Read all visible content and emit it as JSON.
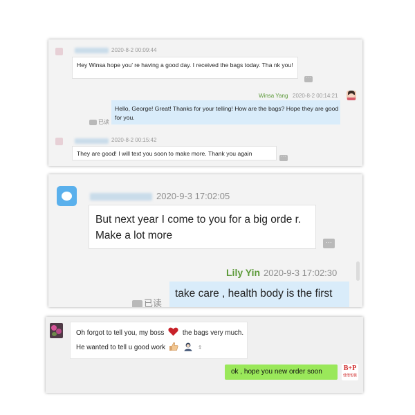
{
  "panel1": {
    "msg1": {
      "time": "2020-8-2 00:09:44",
      "text": "Hey Winsa hope you’ re having a good day. I received the bags today. Tha nk you!"
    },
    "msg2": {
      "sender": "Winsa Yang",
      "time": "2020-8-2 00:14:21",
      "text": "Hello, George! Great! Thanks for your telling! How are the bags? Hope they are good for you.",
      "read": "已读"
    },
    "msg3": {
      "time": "2020-8-2 00:15:42",
      "text": "They are good! I will text you soon to make more. Thank you again"
    }
  },
  "panel2": {
    "msg1": {
      "time": "2020-9-3 17:02:05",
      "text": "But next year I come to you for a big orde r. Make a lot more"
    },
    "msg2": {
      "sender": "Lily Yin",
      "time": "2020-9-3 17:02:30",
      "text": "take care , health body is the first",
      "read": "已读"
    }
  },
  "panel3": {
    "msg1": {
      "text_a": "Oh forgot to tell you, my boss",
      "text_b": "the bags very much. He wanted to tell u good work",
      "female_sign": "♀"
    },
    "msg2": {
      "text": "ok , hope you new order soon",
      "logo": "B+P",
      "logo_sub": "佳倍包装"
    }
  },
  "colors": {
    "sender_name": "#5d9a3a",
    "outgoing_bubble": "#d9ecfa",
    "green_bubble": "#9ae85a"
  },
  "icons": [
    "avatar",
    "heart-icon",
    "thumbs-up-icon",
    "user-emoji-icon",
    "female-sign-icon",
    "more-options-icon"
  ]
}
